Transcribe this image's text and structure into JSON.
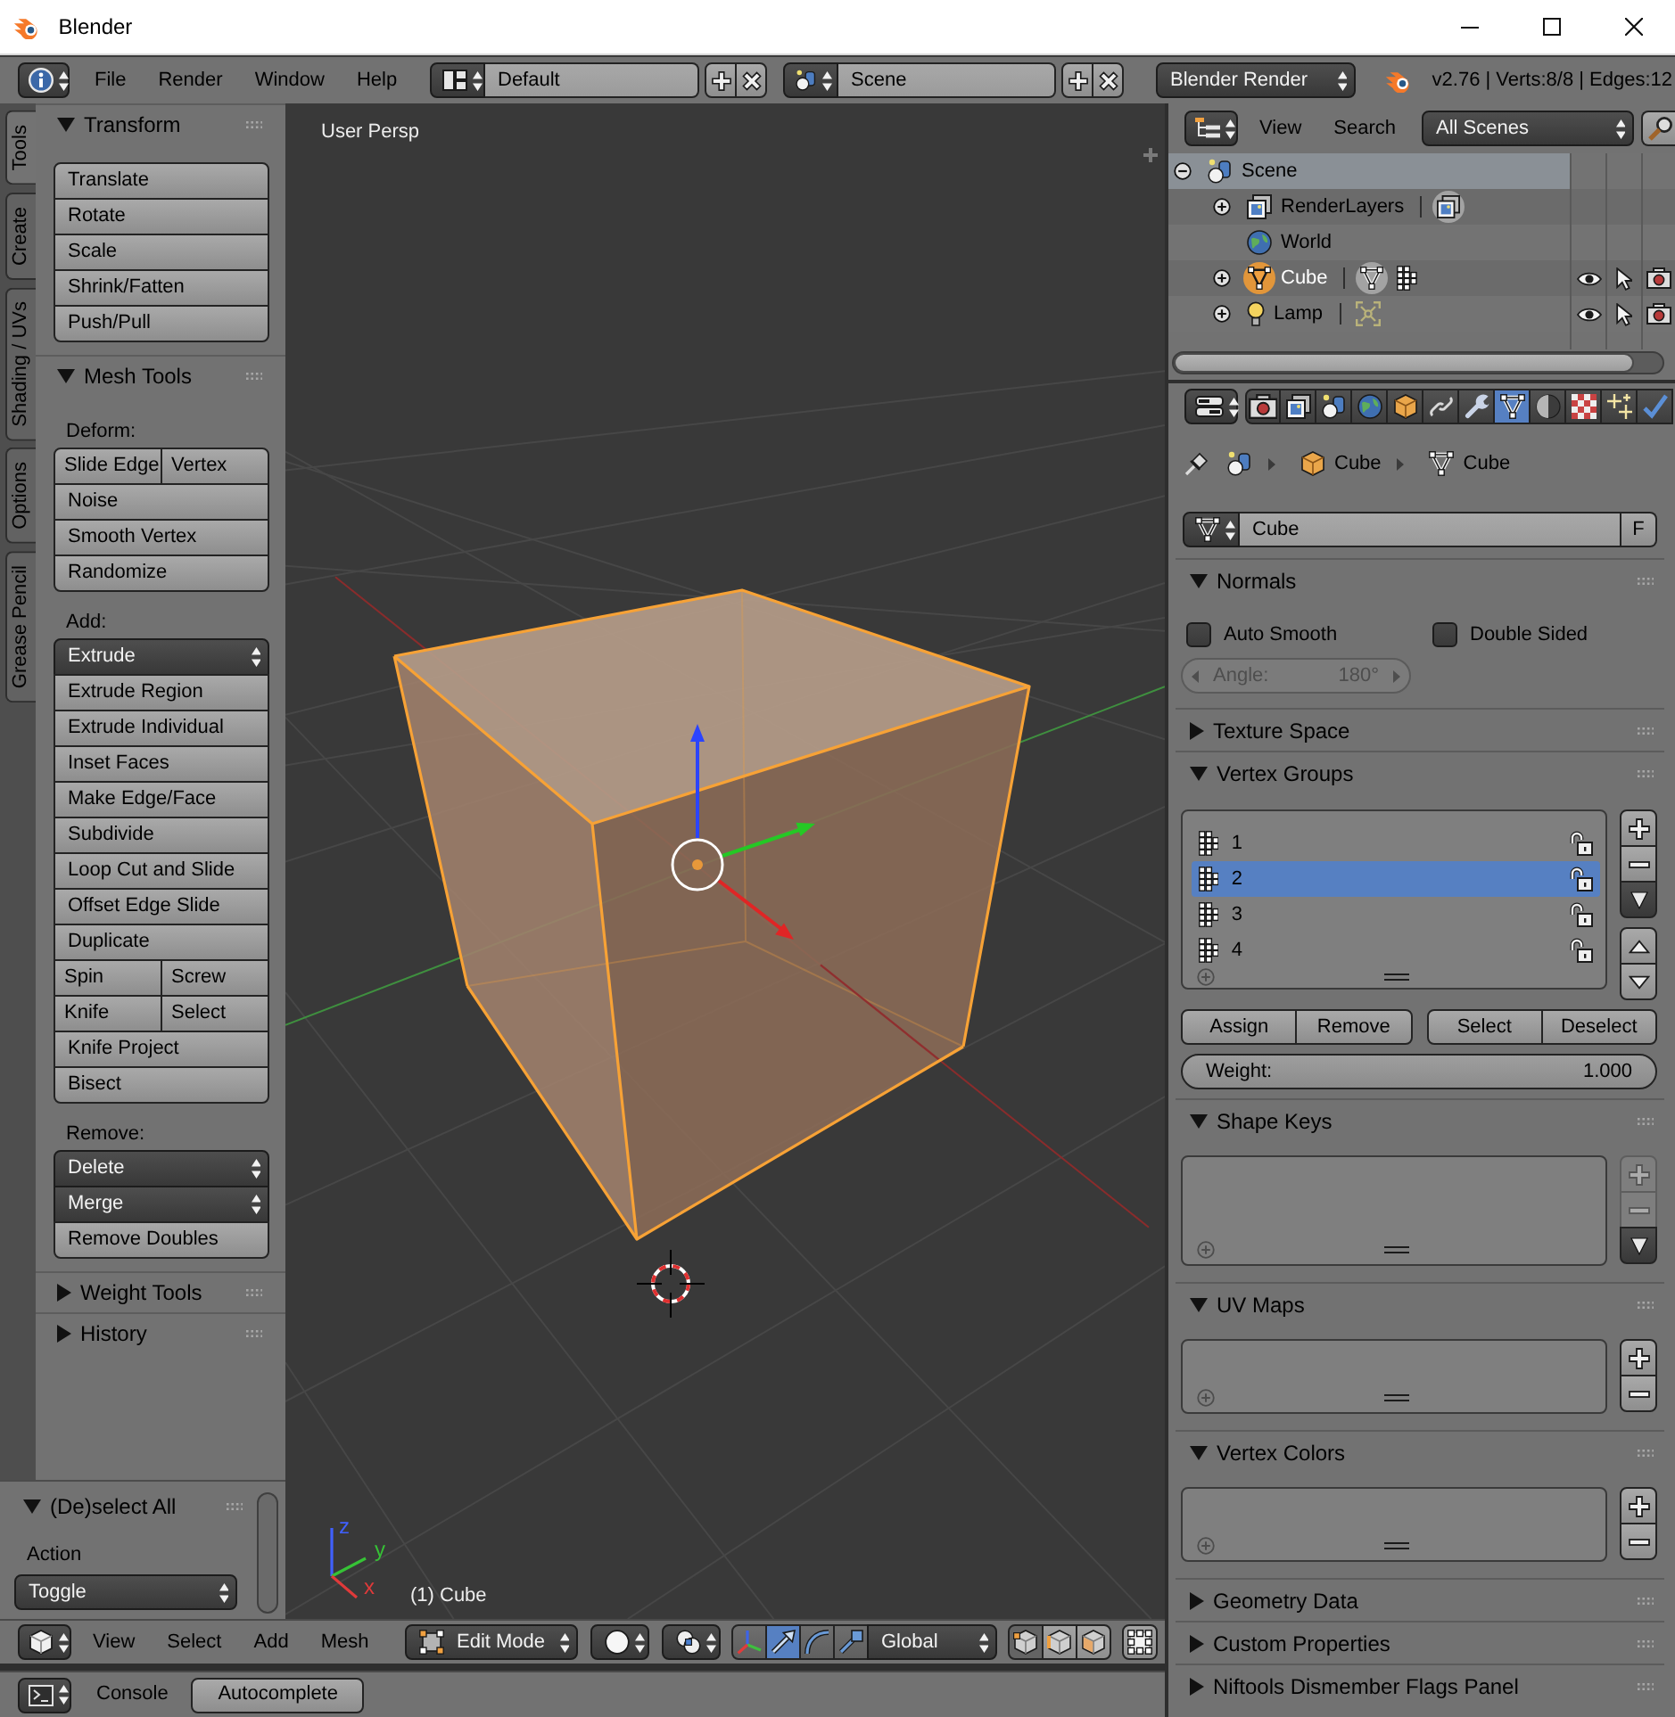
{
  "window": {
    "title": "Blender"
  },
  "info_header": {
    "menus": [
      "File",
      "Render",
      "Window",
      "Help"
    ],
    "layout": "Default",
    "scene": "Scene",
    "engine": "Blender Render",
    "stats": "v2.76 | Verts:8/8 | Edges:12"
  },
  "tool_shelf": {
    "tabs": [
      {
        "label": "Tools",
        "selected": true
      },
      {
        "label": "Create",
        "selected": false
      },
      {
        "label": "Shading / UVs",
        "selected": false
      },
      {
        "label": "Options",
        "selected": false
      },
      {
        "label": "Grease Pencil",
        "selected": false
      }
    ],
    "panels": [
      {
        "title": "Transform",
        "expanded": true,
        "groups": [
          {
            "kind": "buttons",
            "buttons": [
              {
                "kind": "button",
                "label": "Translate"
              },
              {
                "kind": "button",
                "label": "Rotate"
              },
              {
                "kind": "button",
                "label": "Scale"
              },
              {
                "kind": "button",
                "label": "Shrink/Fatten"
              },
              {
                "kind": "button",
                "label": "Push/Pull"
              }
            ]
          }
        ]
      },
      {
        "title": "Mesh Tools",
        "expanded": true,
        "groups": [
          {
            "kind": "label",
            "text": "Deform:"
          },
          {
            "kind": "buttons",
            "buttons": [
              {
                "kind": "pair",
                "labels": [
                  "Slide Edge",
                  "Vertex"
                ]
              },
              {
                "kind": "button",
                "label": "Noise"
              },
              {
                "kind": "button",
                "label": "Smooth Vertex"
              },
              {
                "kind": "button",
                "label": "Randomize"
              }
            ]
          },
          {
            "kind": "label",
            "text": "Add:"
          },
          {
            "kind": "buttons",
            "buttons": [
              {
                "kind": "dropdown",
                "label": "Extrude"
              },
              {
                "kind": "button",
                "label": "Extrude Region"
              },
              {
                "kind": "button",
                "label": "Extrude Individual"
              },
              {
                "kind": "button",
                "label": "Inset Faces"
              },
              {
                "kind": "button",
                "label": "Make Edge/Face"
              },
              {
                "kind": "button",
                "label": "Subdivide"
              },
              {
                "kind": "button",
                "label": "Loop Cut and Slide"
              },
              {
                "kind": "button",
                "label": "Offset Edge Slide"
              },
              {
                "kind": "button",
                "label": "Duplicate"
              },
              {
                "kind": "pair",
                "labels": [
                  "Spin",
                  "Screw"
                ]
              },
              {
                "kind": "pair",
                "labels": [
                  "Knife",
                  "Select"
                ]
              },
              {
                "kind": "button",
                "label": "Knife Project"
              },
              {
                "kind": "button",
                "label": "Bisect"
              }
            ]
          },
          {
            "kind": "label",
            "text": "Remove:"
          },
          {
            "kind": "buttons",
            "buttons": [
              {
                "kind": "dropdown",
                "label": "Delete"
              },
              {
                "kind": "dropdown",
                "label": "Merge"
              },
              {
                "kind": "button",
                "label": "Remove Doubles"
              }
            ]
          }
        ]
      },
      {
        "title": "Weight Tools",
        "expanded": false
      },
      {
        "title": "History",
        "expanded": false
      }
    ]
  },
  "operator_panel": {
    "title": "(De)select All",
    "expanded": true,
    "action": {
      "label": "Action",
      "value": "Toggle"
    }
  },
  "viewport": {
    "view_name": "User Persp",
    "object_label": "(1) Cube",
    "axis_labels": [
      "z",
      "y",
      "x"
    ]
  },
  "view3d_header": {
    "menus": [
      "View",
      "Select",
      "Add",
      "Mesh"
    ],
    "mode": "Edit Mode",
    "manipulators": [
      {
        "kind": "axes",
        "selected": false
      },
      {
        "kind": "translate",
        "selected": true
      },
      {
        "kind": "rotate",
        "selected": false
      },
      {
        "kind": "scale",
        "selected": false
      }
    ],
    "orientation": "Global",
    "select_modes": [
      {
        "kind": "vertex",
        "selected": true
      },
      {
        "kind": "edge",
        "selected": false
      },
      {
        "kind": "face",
        "selected": false
      }
    ]
  },
  "console_header": {
    "menus": [
      "Console"
    ],
    "button": "Autocomplete"
  },
  "outliner": {
    "menus": [
      "View",
      "Search"
    ],
    "display_mode": "All Scenes",
    "tree": [
      {
        "kind": "scene",
        "label": "Scene",
        "expanded": true,
        "selected": true,
        "active": false,
        "children": [
          {
            "kind": "render_layers",
            "label": "RenderLayers",
            "expanded": false,
            "selected": false,
            "active": false
          },
          {
            "kind": "world",
            "label": "World",
            "selected": false,
            "active": false
          },
          {
            "kind": "mesh_object",
            "label": "Cube",
            "expanded": false,
            "selected": false,
            "active": true,
            "visible": true,
            "selectable": true,
            "renderable": true
          },
          {
            "kind": "lamp",
            "label": "Lamp",
            "expanded": false,
            "selected": false,
            "active": false,
            "visible": true,
            "selectable": true,
            "renderable": true
          }
        ]
      }
    ]
  },
  "properties": {
    "tabs": [
      {
        "kind": "render",
        "selected": false
      },
      {
        "kind": "render_layers",
        "selected": false
      },
      {
        "kind": "scene",
        "selected": false
      },
      {
        "kind": "world",
        "selected": false
      },
      {
        "kind": "object",
        "selected": false
      },
      {
        "kind": "constraints",
        "selected": false
      },
      {
        "kind": "modifiers",
        "selected": false
      },
      {
        "kind": "data",
        "selected": true
      },
      {
        "kind": "material",
        "selected": false
      },
      {
        "kind": "texture",
        "selected": false
      },
      {
        "kind": "particles",
        "selected": false
      },
      {
        "kind": "physics",
        "selected": false
      }
    ],
    "breadcrumb": [
      {
        "kind": "scene"
      },
      {
        "kind": "object",
        "label": "Cube"
      },
      {
        "kind": "mesh",
        "label": "Cube"
      }
    ],
    "datablock": {
      "name": "Cube",
      "fake_user": "F"
    },
    "panels": [
      {
        "title": "Normals",
        "expanded": true,
        "kind": "normals",
        "checkboxes": [
          {
            "label": "Auto Smooth",
            "checked": false
          },
          {
            "label": "Double Sided",
            "checked": false
          }
        ],
        "angle": {
          "label": "Angle:",
          "value": "180°",
          "disabled": true
        }
      },
      {
        "title": "Texture Space",
        "expanded": false
      },
      {
        "title": "Vertex Groups",
        "expanded": true,
        "kind": "vertex_groups",
        "groups": [
          {
            "label": "1",
            "selected": false,
            "locked": false
          },
          {
            "label": "2",
            "selected": true,
            "locked": false
          },
          {
            "label": "3",
            "selected": false,
            "locked": false
          },
          {
            "label": "4",
            "selected": false,
            "locked": false
          }
        ],
        "buttons": [
          [
            "Assign",
            "Remove"
          ],
          [
            "Select",
            "Deselect"
          ]
        ],
        "weight": {
          "label": "Weight:",
          "value": "1.000"
        }
      },
      {
        "title": "Shape Keys",
        "expanded": true,
        "kind": "shape_keys",
        "buttons_disabled": true
      },
      {
        "title": "UV Maps",
        "expanded": true,
        "kind": "data_layers",
        "buttons_disabled": false
      },
      {
        "title": "Vertex Colors",
        "expanded": true,
        "kind": "data_layers",
        "buttons_disabled": false
      },
      {
        "title": "Geometry Data",
        "expanded": false
      },
      {
        "title": "Custom Properties",
        "expanded": false
      },
      {
        "title": "Niftools Dismember Flags Panel",
        "expanded": false
      }
    ]
  }
}
